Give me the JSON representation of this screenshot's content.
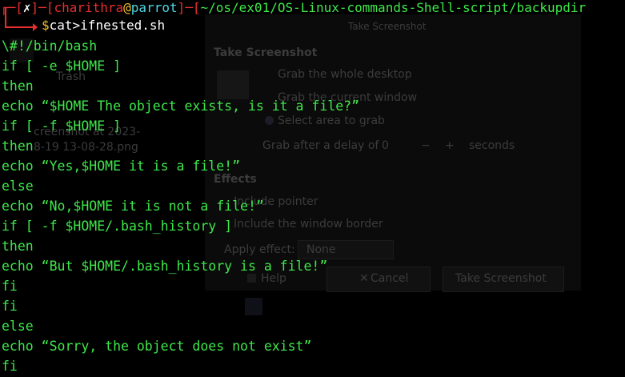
{
  "prompt": {
    "x_mark": "✗",
    "user": "charithra",
    "at": "@",
    "host": "parrot",
    "path": "~/os/ex01/OS-Linux-commands-Shell-script/backupdir",
    "dollar": "$",
    "command": "cat>ifnested.sh"
  },
  "script_lines": [
    "\\#!/bin/bash",
    "if [ -e $HOME ]",
    "then",
    "echo “$HOME The object exists, is it a file?”",
    "if [ -f $HOME ]",
    "then",
    "echo “Yes,$HOME it is a file!”",
    "else",
    "echo “No,$HOME it is not a file!”",
    "if [ -f $HOME/.bash_history ]",
    "then",
    "echo “But $HOME/.bash_history is a file!”",
    "fi",
    "fi",
    "else",
    "echo “Sorry, the object does not exist”",
    "fi"
  ],
  "background_dialog": {
    "window_title": "Take Screenshot",
    "section_title": "Take Screenshot",
    "option_desktop": "Grab the whole desktop",
    "option_window": "Grab the current window",
    "option_area": "Select area to grab",
    "delay_label": "Grab after a delay of",
    "delay_value": "0",
    "delay_minus": "−",
    "delay_plus": "+",
    "delay_unit": "seconds",
    "effects_title": "Effects",
    "include_pointer": "Include pointer",
    "include_border": "Include the window border",
    "apply_effect_label": "Apply effect:",
    "apply_effect_value": "None",
    "help_button": "Help",
    "cancel_button": "Cancel",
    "take_button": "Take Screenshot",
    "cancel_x": "✕"
  },
  "desktop": {
    "trash_label": "Trash",
    "file_label_1": "creenshot at 2023-",
    "file_label_2": "8-19 13-08-28.png"
  }
}
